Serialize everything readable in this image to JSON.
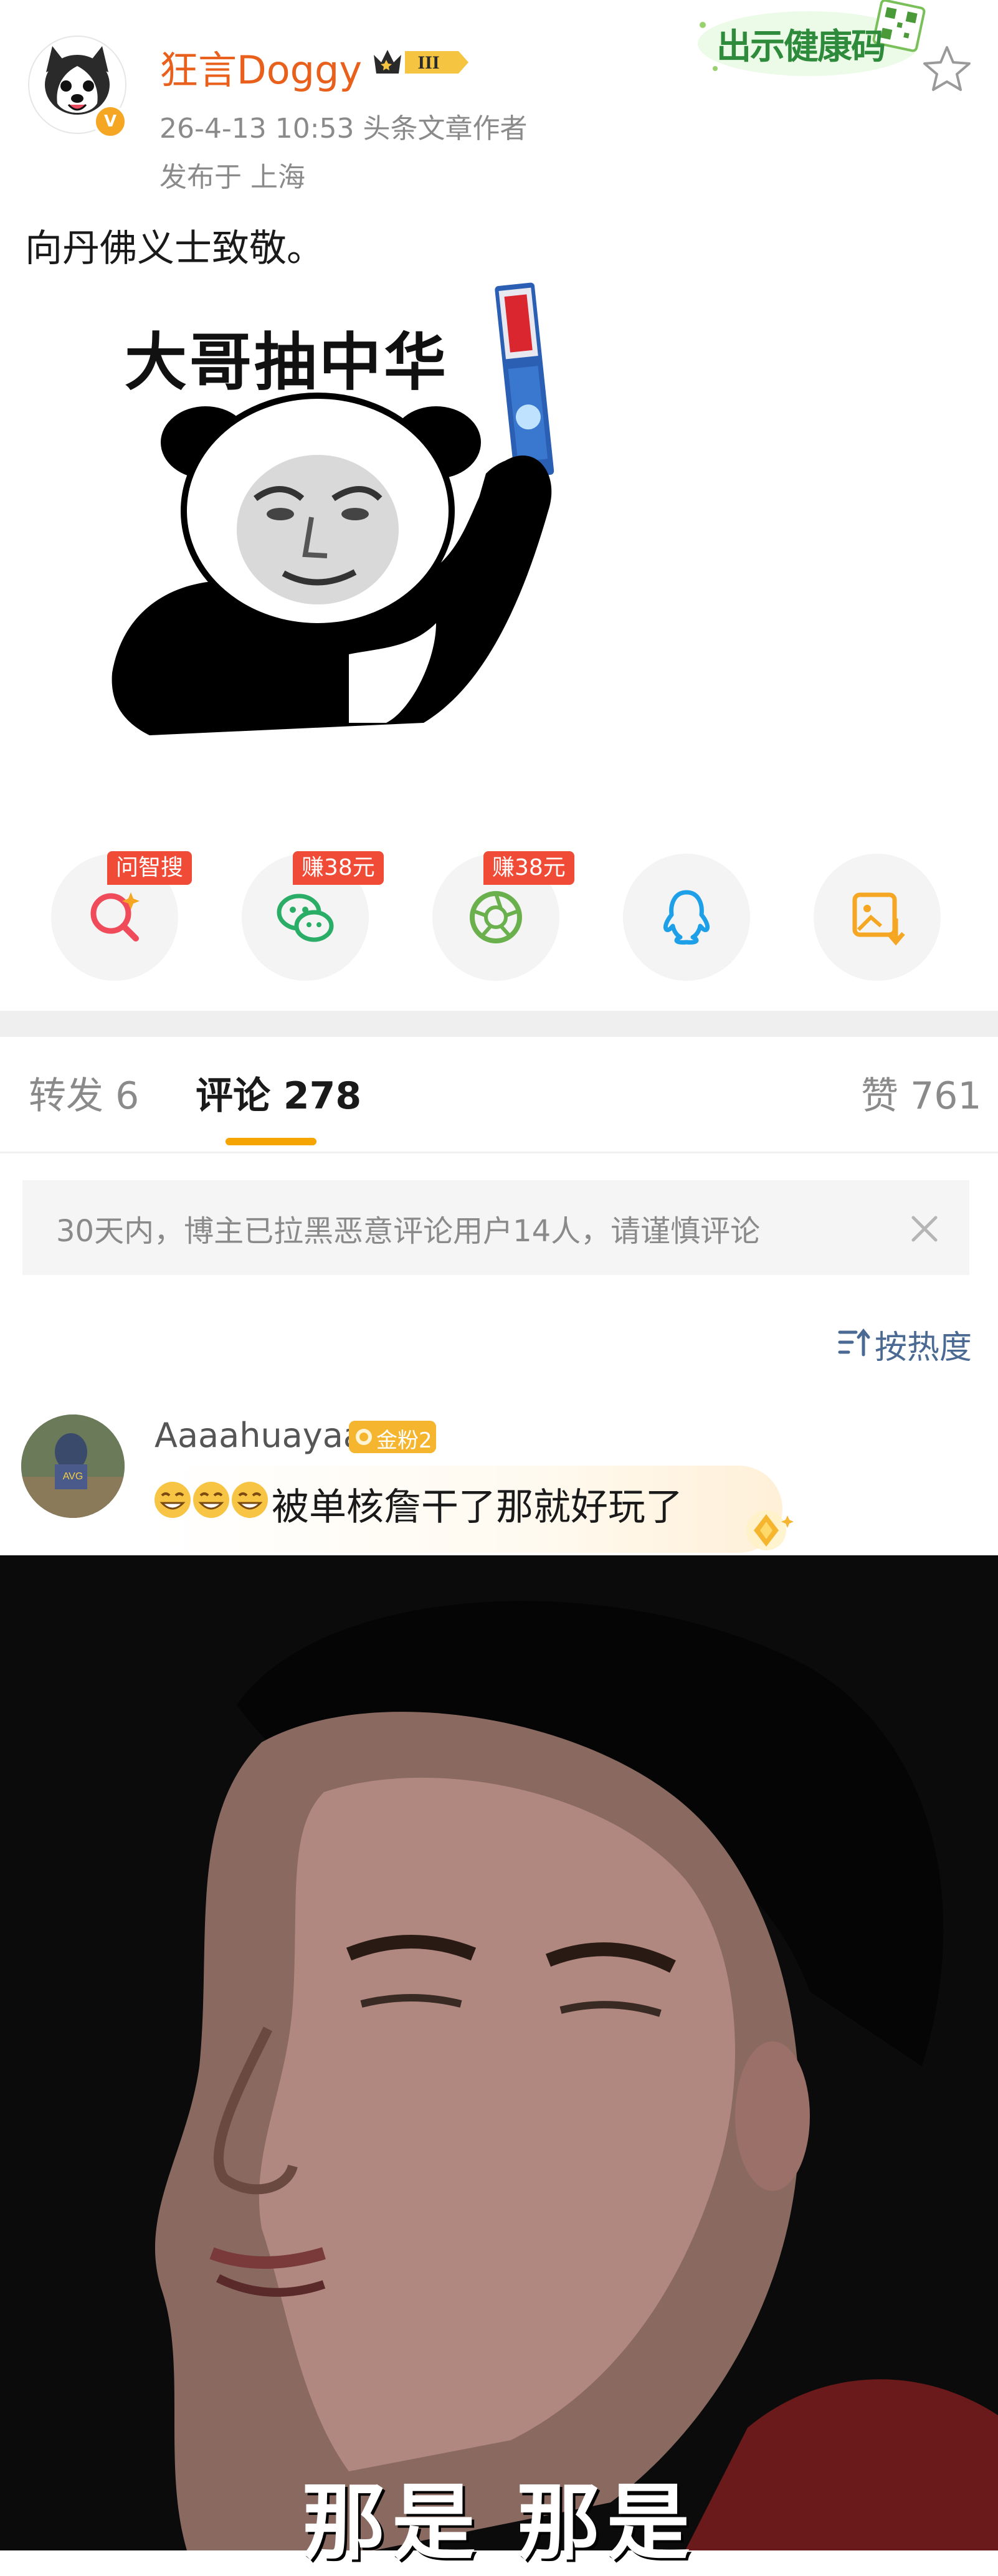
{
  "header": {
    "author_name": "狂言Doggy",
    "badge_level": "III",
    "meta": "26-4-13 10:53  头条文章作者",
    "location": "发布于 上海",
    "health_code": "出示健康码"
  },
  "post": {
    "text": "向丹佛义士致敬。",
    "meme_caption": "大哥抽中华"
  },
  "share": {
    "items": [
      {
        "name": "search-icon",
        "tag": "问智搜",
        "color": "#f04b5a"
      },
      {
        "name": "wechat-icon",
        "tag": "赚38元",
        "color": "#2aae67"
      },
      {
        "name": "moments-icon",
        "tag": "赚38元",
        "color": "#6ab04c"
      },
      {
        "name": "qq-icon",
        "tag": "",
        "color": "#1ea0e8"
      },
      {
        "name": "save-image-icon",
        "tag": "",
        "color": "#f5a623"
      }
    ]
  },
  "tabs": {
    "repost": "转发 6",
    "comments": "评论 278",
    "likes": "赞 761"
  },
  "notice": {
    "text": "30天内，博主已拉黑恶意评论用户14人，请谨慎评论"
  },
  "sort": {
    "label": "按热度"
  },
  "comment": {
    "user": "Aaaahuayaa",
    "fan_badge": "金粉2",
    "text": "被单核詹干了那就好玩了",
    "emoji": [
      "grin",
      "grin",
      "grin"
    ],
    "reply_caption": "那是  那是"
  },
  "colors": {
    "author_orange": "#e8601c",
    "accent_yellow": "#f5a400",
    "tag_red": "#f04b36",
    "sort_blue": "#4a6a93"
  }
}
